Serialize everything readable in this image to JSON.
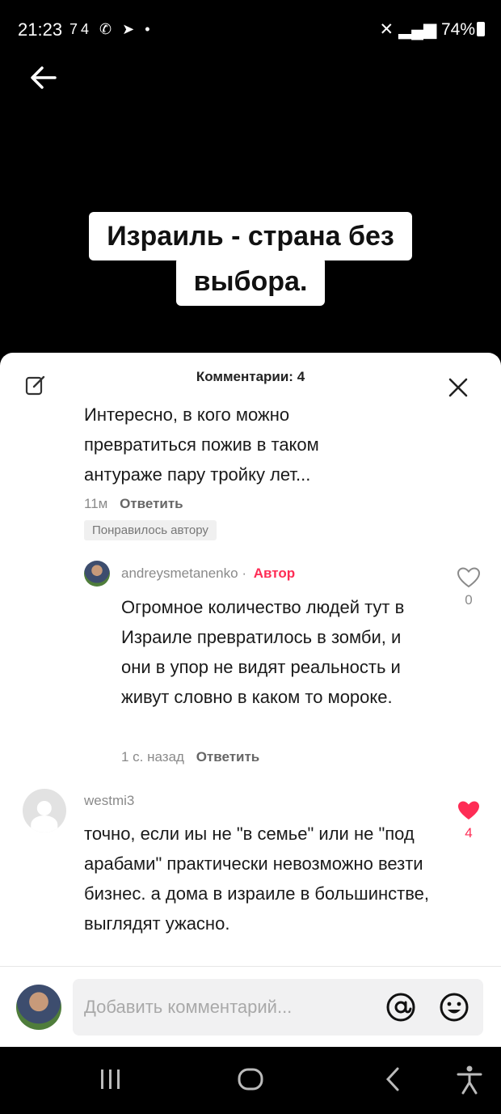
{
  "status_bar": {
    "time": "21:23",
    "left_icons": "74 ✆ ➤ •",
    "right_text": "74%"
  },
  "video": {
    "caption_line1": "Израиль - страна без",
    "caption_line2": "выбора."
  },
  "comments": {
    "header": "Комментарии: 4",
    "first": {
      "text": "Интересно, в кого можно превратиться пожив в таком антураже пару тройку лет...",
      "time": "11м",
      "reply": "Ответить",
      "liked_badge": "Понравилось автору"
    },
    "reply_comment": {
      "username": "andreysmetanenko ·",
      "author_badge": "Автор",
      "text": "Огромное количество людей тут в Израиле превратилось в зомби, и они в упор не видят реальность и живут словно в каком то мороке.",
      "time": "1 с. назад",
      "reply": "Ответить",
      "likes": "0"
    },
    "third": {
      "username": "westmi3",
      "text": "точно, если иы не \"в семье\" или не \"под арабами\" практически невозможно везти бизнес. а дома в израиле в большинстве, выглядят ужасно.",
      "likes": "4"
    }
  },
  "composer": {
    "placeholder": "Добавить комментарий..."
  },
  "colors": {
    "accent": "#fe2c55",
    "sheet": "#ffffff",
    "background": "#000000"
  }
}
